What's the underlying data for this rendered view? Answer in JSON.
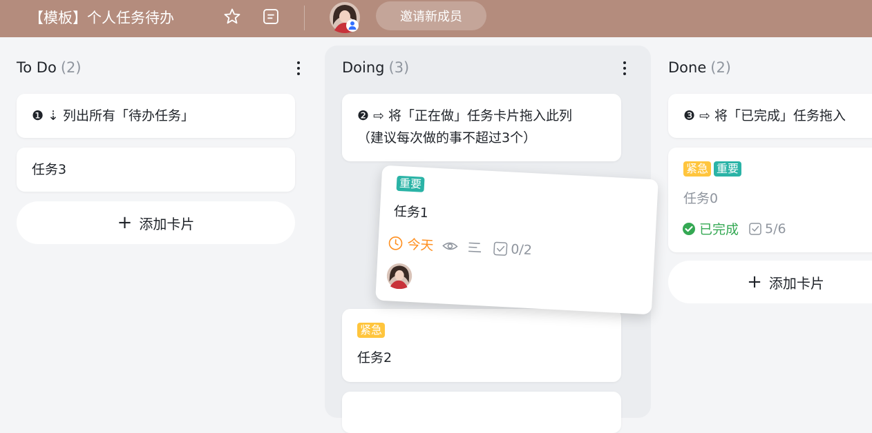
{
  "header": {
    "title": "【模板】个人任务待办",
    "invite_label": "邀请新成员"
  },
  "colors": {
    "header_bg": "#b48c7d",
    "tag_urgent": "#ffc53d",
    "tag_important": "#2ab3a6",
    "due_today": "#ff8f1f",
    "completed": "#34a853"
  },
  "columns": [
    {
      "title": "To Do",
      "count": "(2)",
      "cards": [
        {
          "prefix": "❶ ⇣",
          "text": "列出所有「待办任务」"
        },
        {
          "text": "任务3"
        }
      ],
      "add_label": "添加卡片"
    },
    {
      "title": "Doing",
      "count": "(3)",
      "cards": [
        {
          "prefix": "❷ ⇨",
          "text": "将「正在做」任务卡片拖入此列",
          "text2": "（建议每次做的事不超过3个）"
        },
        {
          "tag": "紧急",
          "text": "任务2"
        }
      ],
      "dragging_card": {
        "tag": "重要",
        "text": "任务1",
        "due": "今天",
        "checklist": "0/2",
        "icons": [
          "clock-icon",
          "eye-icon",
          "description-icon",
          "checklist-icon"
        ]
      }
    },
    {
      "title": "Done",
      "count": "(2)",
      "cards": [
        {
          "prefix": "❸ ⇨",
          "text": "将「已完成」任务拖入"
        },
        {
          "tags": [
            "紧急",
            "重要"
          ],
          "text": "任务0",
          "status": "已完成",
          "checklist": "5/6"
        }
      ],
      "add_label": "添加卡片"
    }
  ]
}
